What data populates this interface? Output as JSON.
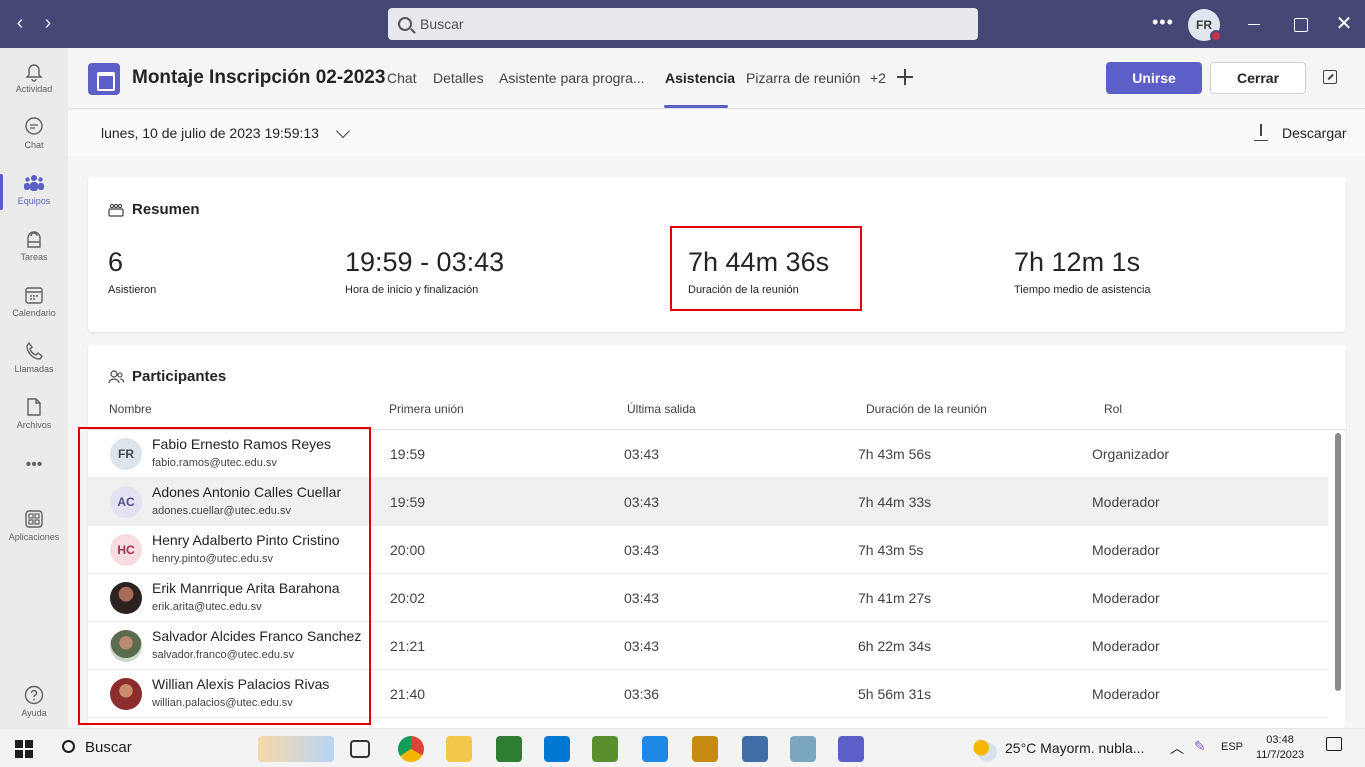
{
  "titlebar": {
    "search_placeholder": "Buscar",
    "user_initials": "FR"
  },
  "rail": [
    {
      "label": "Actividad",
      "icon": "bell-icon"
    },
    {
      "label": "Chat",
      "icon": "chat-icon"
    },
    {
      "label": "Equipos",
      "icon": "teams-icon",
      "active": true
    },
    {
      "label": "Tareas",
      "icon": "tasks-icon"
    },
    {
      "label": "Calendario",
      "icon": "calendar-icon"
    },
    {
      "label": "Llamadas",
      "icon": "phone-icon"
    },
    {
      "label": "Archivos",
      "icon": "file-icon"
    },
    {
      "label": "...",
      "icon": "more-icon"
    },
    {
      "label": "Aplicaciones",
      "icon": "apps-icon"
    },
    {
      "label": "Ayuda",
      "icon": "help-icon"
    }
  ],
  "header": {
    "title": "Montaje Inscripción 02-2023",
    "tabs": [
      "Chat",
      "Detalles",
      "Asistente para progra...",
      "Asistencia",
      "Pizarra de reunión",
      "+2"
    ],
    "active_tab": "Asistencia",
    "join_label": "Unirse",
    "close_label": "Cerrar"
  },
  "toolbar": {
    "date": "lunes, 10 de julio de 2023 19:59:13",
    "download_label": "Descargar"
  },
  "summary": {
    "heading": "Resumen",
    "stats": [
      {
        "value": "6",
        "label": "Asistieron"
      },
      {
        "value": "19:59 - 03:43",
        "label": "Hora de inicio y finalización"
      },
      {
        "value": "7h 44m 36s",
        "label": "Duración de la reunión"
      },
      {
        "value": "7h 12m 1s",
        "label": "Tiempo medio de asistencia"
      }
    ]
  },
  "participants": {
    "heading": "Participantes",
    "columns": [
      "Nombre",
      "Primera unión",
      "Última salida",
      "Duración de la reunión",
      "Rol"
    ],
    "rows": [
      {
        "initials": "FR",
        "name": "Fabio Ernesto Ramos Reyes",
        "email": "fabio.ramos@utec.edu.sv",
        "first_join": "19:59",
        "last_leave": "03:43",
        "duration": "7h 43m 56s",
        "role": "Organizador"
      },
      {
        "initials": "AC",
        "name": "Adones Antonio Calles Cuellar",
        "email": "adones.cuellar@utec.edu.sv",
        "first_join": "19:59",
        "last_leave": "03:43",
        "duration": "7h 44m 33s",
        "role": "Moderador"
      },
      {
        "initials": "HC",
        "name": "Henry Adalberto Pinto Cristino",
        "email": "henry.pinto@utec.edu.sv",
        "first_join": "20:00",
        "last_leave": "03:43",
        "duration": "7h 43m 5s",
        "role": "Moderador"
      },
      {
        "initials": "",
        "name": "Erik Manrrique Arita Barahona",
        "email": "erik.arita@utec.edu.sv",
        "first_join": "20:02",
        "last_leave": "03:43",
        "duration": "7h 41m 27s",
        "role": "Moderador"
      },
      {
        "initials": "",
        "name": "Salvador Alcides Franco Sanchez",
        "email": "salvador.franco@utec.edu.sv",
        "first_join": "21:21",
        "last_leave": "03:43",
        "duration": "6h 22m 34s",
        "role": "Moderador"
      },
      {
        "initials": "",
        "name": "Willian Alexis Palacios Rivas",
        "email": "willian.palacios@utec.edu.sv",
        "first_join": "21:40",
        "last_leave": "03:36",
        "duration": "5h 56m 31s",
        "role": "Moderador"
      }
    ]
  },
  "taskbar": {
    "search_label": "Buscar",
    "weather": "25°C  Mayorm. nubla...",
    "lang": "ESP",
    "time": "03:48",
    "date": "11/7/2023"
  },
  "colors": {
    "accent": "#5b5fc7",
    "titlebar": "#464775",
    "highlight": "#e00000"
  }
}
